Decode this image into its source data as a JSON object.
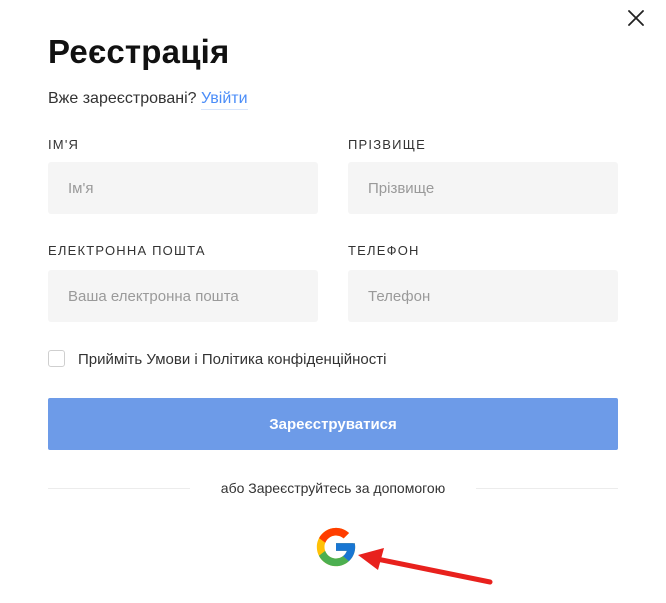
{
  "dialog": {
    "title": "Реєстрація",
    "close_icon": "close-icon"
  },
  "login": {
    "prompt": "Вже зареєстровані?",
    "link_label": "Увійти"
  },
  "fields": {
    "first_name": {
      "label": "ІМ'Я",
      "placeholder": "Ім'я",
      "value": ""
    },
    "last_name": {
      "label": "ПРІЗВИЩЕ",
      "placeholder": "Прізвище",
      "value": ""
    },
    "email": {
      "label": "ЕЛЕКТРОННА ПОШТА",
      "placeholder": "Ваша електронна пошта",
      "value": ""
    },
    "phone": {
      "label": "ТЕЛЕФОН",
      "placeholder": "Телефон",
      "value": ""
    }
  },
  "terms": {
    "checked": false,
    "text": "Прийміть Умови і Політика конфіденційності"
  },
  "submit": {
    "label": "Зареєструватися"
  },
  "social": {
    "divider_text": "або Зареєструйтесь за допомогою",
    "google_icon": "google-icon"
  },
  "annotation": {
    "icon": "red-arrow-icon",
    "color": "#e8211d"
  },
  "colors": {
    "accent": "#4b8df8",
    "button": "#6d9be8",
    "input_bg": "#f5f5f5",
    "google_blue": "#4285F4",
    "google_red": "#EA4335",
    "google_yellow": "#FBBC05",
    "google_green": "#34A853"
  }
}
